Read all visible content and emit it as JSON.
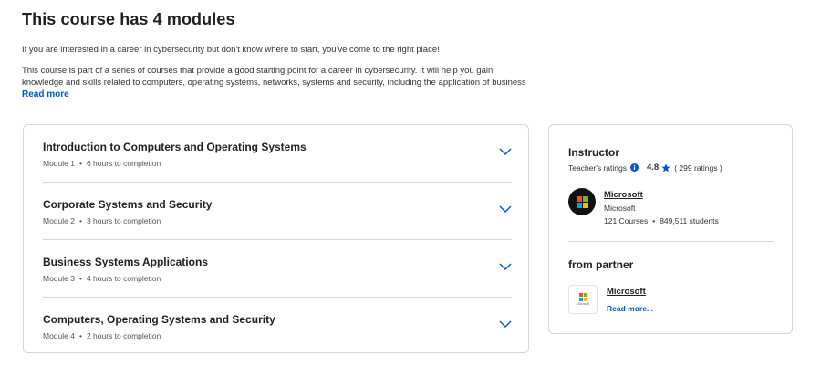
{
  "header": {
    "title": "This course has 4 modules"
  },
  "intro": {
    "paragraph1": "If you are interested in a career in cybersecurity but don't know where to start, you've come to the right place!",
    "paragraph2": "This course is part of a series of courses that provide a good starting point for a career in cybersecurity. It will help you gain knowledge and skills related to computers, operating systems, networks, systems and security, including the application of business systems.",
    "read_more": "Read more"
  },
  "modules": [
    {
      "title": "Introduction to Computers and Operating Systems",
      "number": "Module 1",
      "duration": "6 hours to completion"
    },
    {
      "title": "Corporate Systems and Security",
      "number": "Module 2",
      "duration": "3 hours to completion"
    },
    {
      "title": "Business Systems Applications",
      "number": "Module 3",
      "duration": "4 hours to completion"
    },
    {
      "title": "Computers, Operating Systems and Security",
      "number": "Module 4",
      "duration": "2 hours to completion"
    }
  ],
  "module_separator": "•",
  "instructor": {
    "heading": "Instructor",
    "ratings_label": "Teacher's ratings",
    "rating": "4.8",
    "rating_count": "( 299 ratings )",
    "name": "Microsoft",
    "org": "Microsoft",
    "courses": "121 Courses",
    "separator": "•",
    "students": "849,511 students"
  },
  "partner": {
    "heading": "from partner",
    "name": "Microsoft",
    "read_more": "Read more...",
    "logo_text": "Microsoft"
  },
  "icons": {
    "chevron": "chevron-down-icon",
    "info": "info-icon",
    "star": "star-icon",
    "logo": "microsoft-logo"
  },
  "colors": {
    "accent": "#0056d2",
    "ms_red": "#f25022",
    "ms_green": "#7fba00",
    "ms_blue": "#00a4ef",
    "ms_yellow": "#ffb900"
  }
}
